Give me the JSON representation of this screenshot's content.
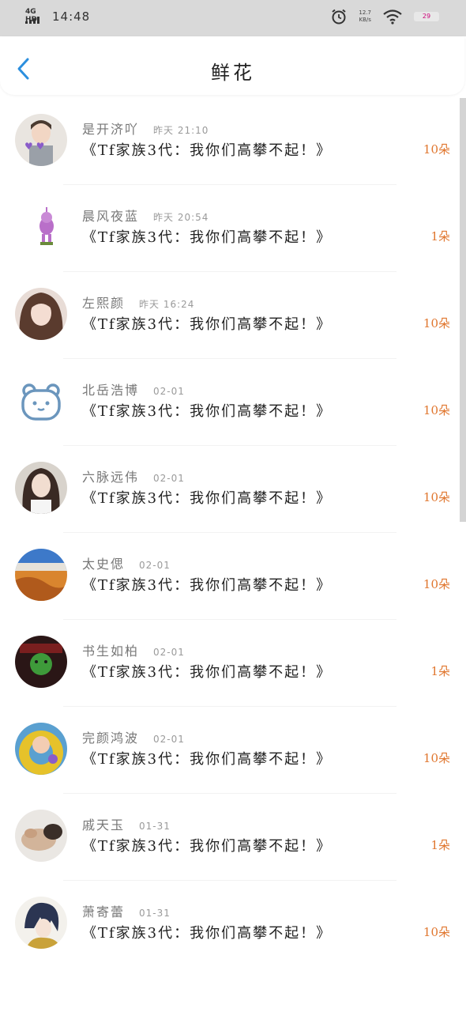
{
  "status_bar": {
    "network": "4G HD",
    "time": "14:48",
    "speed_value": "12.7",
    "speed_unit": "KB/s",
    "battery": "29"
  },
  "header": {
    "title": "鲜花",
    "back_icon": "chevron-left-icon"
  },
  "colors": {
    "accent": "#2c8fde",
    "count": "#e0762e",
    "status_bg": "#d9d9d9"
  },
  "items": [
    {
      "name": "是开济吖",
      "time": "昨天 21:10",
      "message": "《Tf家族3代：我你们高攀不起！》",
      "count": "10朵"
    },
    {
      "name": "晨风夜蓝",
      "time": "昨天 20:54",
      "message": "《Tf家族3代：我你们高攀不起！》",
      "count": "1朵"
    },
    {
      "name": "左熙颜",
      "time": "昨天 16:24",
      "message": "《Tf家族3代：我你们高攀不起！》",
      "count": "10朵"
    },
    {
      "name": "北岳浩博",
      "time": "02-01",
      "message": "《Tf家族3代：我你们高攀不起！》",
      "count": "10朵"
    },
    {
      "name": "六脉远伟",
      "time": "02-01",
      "message": "《Tf家族3代：我你们高攀不起！》",
      "count": "10朵"
    },
    {
      "name": "太史偲",
      "time": "02-01",
      "message": "《Tf家族3代：我你们高攀不起！》",
      "count": "10朵"
    },
    {
      "name": "书生如柏",
      "time": "02-01",
      "message": "《Tf家族3代：我你们高攀不起！》",
      "count": "1朵"
    },
    {
      "name": "完颜鸿波",
      "time": "02-01",
      "message": "《Tf家族3代：我你们高攀不起！》",
      "count": "10朵"
    },
    {
      "name": "戚天玉",
      "time": "01-31",
      "message": "《Tf家族3代：我你们高攀不起！》",
      "count": "1朵"
    },
    {
      "name": "萧寄蕾",
      "time": "01-31",
      "message": "《Tf家族3代：我你们高攀不起！》",
      "count": "10朵"
    }
  ]
}
